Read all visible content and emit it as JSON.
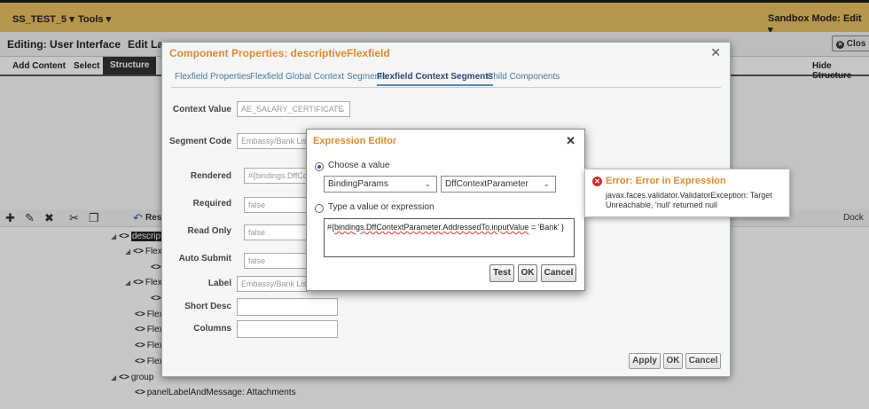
{
  "topbar": {
    "sandbox_name": "SS_TEST_5 ▾",
    "tools_menu": "Tools ▾",
    "sandbox_mode": "Sandbox Mode: Edit ▾"
  },
  "editbar": {
    "editing_label": "Editing: User Interface",
    "edit_layout": "Edit Lay",
    "close_button": "Clos"
  },
  "tabs": {
    "add_content": "Add Content",
    "select": "Select",
    "structure": "Structure",
    "hide_structure": "Hide Structure"
  },
  "structure_toolbar": {
    "dock": "Dock",
    "res": "Res"
  },
  "tree": [
    {
      "tag": "<>",
      "label": "descript"
    },
    {
      "tag": "<>",
      "label": "Flex"
    },
    {
      "tag": "<>",
      "label": ""
    },
    {
      "tag": "<>",
      "label": "Flex"
    },
    {
      "tag": "<>",
      "label": ""
    },
    {
      "tag": "<>",
      "label": "Flex"
    },
    {
      "tag": "<>",
      "label": "Flex"
    },
    {
      "tag": "<>",
      "label": "Flex"
    },
    {
      "tag": "<>",
      "label": "Flex"
    },
    {
      "tag": "<>",
      "label": "group"
    },
    {
      "tag": "<>",
      "label": "panelLabelAndMessage: Attachments"
    }
  ],
  "component_dialog": {
    "title": "Component Properties: descriptiveFlexfield",
    "tabs": [
      "Flexfield Properties",
      "Flexfield Global Context Segments",
      "Flexfield Context Segments",
      "Child Components"
    ],
    "active_tab": "Flexfield Context Segments",
    "fields": {
      "context_value_label": "Context Value",
      "context_value": "AE_SALARY_CERTIFICATE",
      "segment_code_label": "Segment Code",
      "segment_code": "Embassy/Bank List",
      "rendered_label": "Rendered",
      "rendered": "#{bindings.DffCo",
      "required_label": "Required",
      "required": "false",
      "read_only_label": "Read Only",
      "read_only": "false",
      "auto_submit_label": "Auto Submit",
      "auto_submit": "false",
      "label_label": "Label",
      "label": "Embassy/Bank List",
      "short_desc_label": "Short Desc",
      "short_desc": "",
      "columns_label": "Columns",
      "columns": ""
    },
    "buttons": {
      "apply": "Apply",
      "ok": "OK",
      "cancel": "Cancel"
    }
  },
  "expression_editor": {
    "title": "Expression Editor",
    "choose_value_label": "Choose a value",
    "select_source": "BindingParams",
    "select_param": "DffContextParameter",
    "type_value_label": "Type a value or expression",
    "expression_prefix": "#{",
    "expression_body": "bindings.DffContextParameter.AddressedTo.inputValue",
    "expression_suffix": " = 'Bank' }",
    "buttons": {
      "test": "Test",
      "ok": "OK",
      "cancel": "Cancel"
    }
  },
  "error_popup": {
    "title": "Error: Error in Expression",
    "message": "javax.faces.validator.ValidatorException: Target Unreachable, 'null' returned null"
  }
}
